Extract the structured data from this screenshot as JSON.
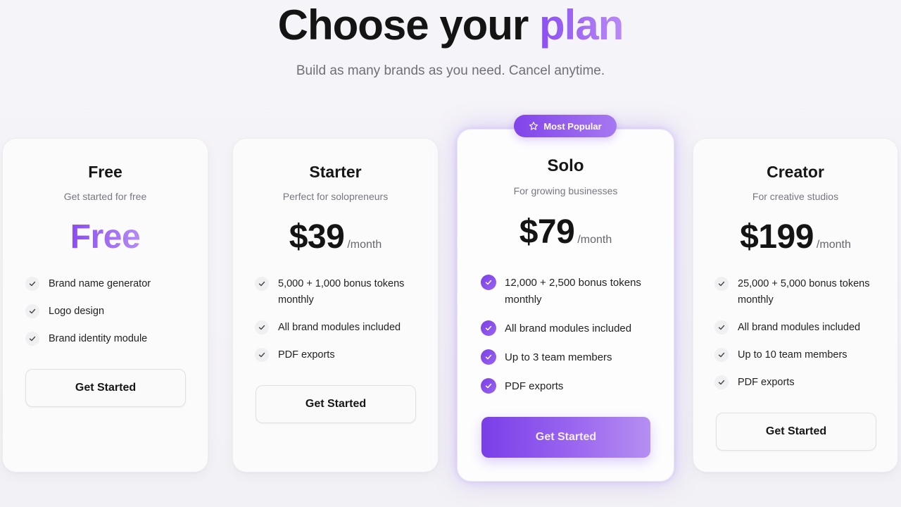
{
  "header": {
    "title_main": "Choose your",
    "title_accent": "plan",
    "subtitle": "Build as many brands as you need. Cancel anytime."
  },
  "badge": {
    "label": "Most Popular",
    "icon": "star-icon"
  },
  "plans": [
    {
      "name": "Free",
      "description": "Get started for free",
      "price": "Free",
      "period": "",
      "features": [
        "Brand name generator",
        "Logo design",
        "Brand identity module"
      ],
      "cta": "Get Started"
    },
    {
      "name": "Starter",
      "description": "Perfect for solopreneurs",
      "price": "$39",
      "period": "/month",
      "features": [
        "5,000 + 1,000 bonus tokens monthly",
        "All brand modules included",
        "PDF exports"
      ],
      "cta": "Get Started"
    },
    {
      "name": "Solo",
      "description": "For growing businesses",
      "price": "$79",
      "period": "/month",
      "features": [
        "12,000 + 2,500 bonus tokens monthly",
        "All brand modules included",
        "Up to 3 team members",
        "PDF exports"
      ],
      "cta": "Get Started",
      "featured": true
    },
    {
      "name": "Creator",
      "description": "For creative studios",
      "price": "$199",
      "period": "/month",
      "features": [
        "25,000 + 5,000 bonus tokens monthly",
        "All brand modules included",
        "Up to 10 team members",
        "PDF exports"
      ],
      "cta": "Get Started"
    }
  ],
  "colors": {
    "accent": "#8b4ff0",
    "accent_light": "#b98af5",
    "text": "#141414",
    "muted": "#777780"
  }
}
